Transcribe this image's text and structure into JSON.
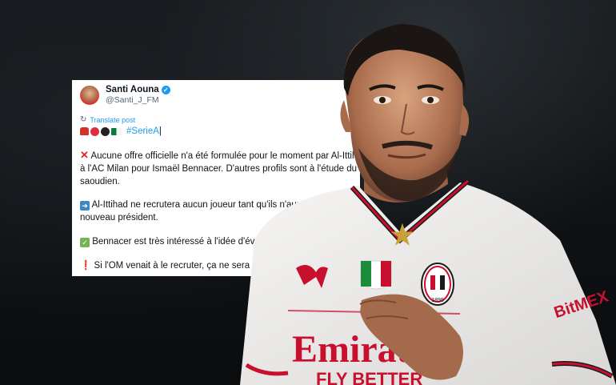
{
  "tweet": {
    "display_name": "Santi Aouna",
    "handle": "@Santi_J_FM",
    "translate_label": "Translate post",
    "hashtag": "#SerieA",
    "emoji_line_end": "|",
    "paragraphs": [
      {
        "icon": "cross-mark-icon",
        "lines": [
          "Aucune offre officielle n'a été formulée pour le moment par Al-Ittihad",
          "à l'AC Milan pour Ismaël Bennacer. D'autres profils sont à l'étude du côté",
          "saoudien."
        ]
      },
      {
        "icon": "right-arrow-icon",
        "lines": [
          "Al-Ittihad ne recrutera aucun joueur tant qu'ils n'auront pas un",
          "nouveau président."
        ]
      },
      {
        "icon": "check-mark-icon",
        "lines": [
          "Bennacer est très intéressé à l'idée d'évoluer en Arabie Saoudite."
        ]
      },
      {
        "icon": "exclamation-icon",
        "lines": [
          "Si l'OM venait à le recruter, ça ne sera qu'à des conditions réduites."
        ]
      }
    ]
  },
  "jersey": {
    "sponsor_line1": "Emirates",
    "sponsor_line2": "FLY BETTER",
    "crest_text": "ACM",
    "crest_year": "1899",
    "sleeve_sponsor": "BitMEX"
  },
  "colors": {
    "link_blue": "#1d9bf0",
    "milan_red": "#c8102e",
    "shirt_white": "#f1f0ee"
  }
}
